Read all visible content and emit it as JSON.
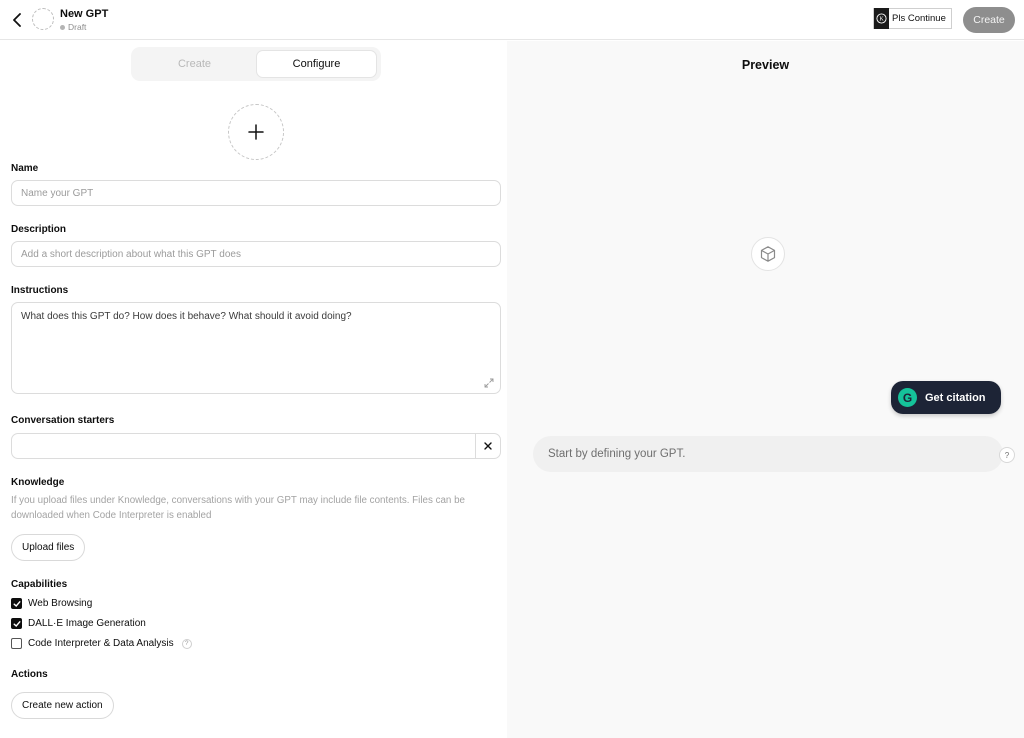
{
  "header": {
    "title": "New GPT",
    "status": "Draft",
    "extension_label": "Pls Continue",
    "create_button": "Create"
  },
  "tabs": [
    {
      "label": "Create",
      "active": false
    },
    {
      "label": "Configure",
      "active": true
    }
  ],
  "form": {
    "name": {
      "label": "Name",
      "placeholder": "Name your GPT"
    },
    "description": {
      "label": "Description",
      "placeholder": "Add a short description about what this GPT does"
    },
    "instructions": {
      "label": "Instructions",
      "placeholder": "What does this GPT do? How does it behave? What should it avoid doing?"
    },
    "starters": {
      "label": "Conversation starters",
      "value": ""
    },
    "knowledge": {
      "label": "Knowledge",
      "help": "If you upload files under Knowledge, conversations with your GPT may include file contents. Files can be downloaded when Code Interpreter is enabled",
      "upload_button": "Upload files"
    },
    "capabilities": {
      "label": "Capabilities",
      "items": [
        {
          "label": "Web Browsing",
          "checked": true
        },
        {
          "label": "DALL·E Image Generation",
          "checked": true
        },
        {
          "label": "Code Interpreter & Data Analysis",
          "checked": false
        }
      ]
    },
    "actions": {
      "label": "Actions",
      "button": "Create new action"
    }
  },
  "preview": {
    "title": "Preview",
    "composer_placeholder": "Start by defining your GPT.",
    "help_label": "?"
  },
  "grammarly": {
    "label": "Get citation",
    "logo": "G"
  },
  "colors": {
    "citation_bg": "#1d2436",
    "grammarly_green": "#15c39a",
    "create_disabled": "#8e8e8e"
  },
  "icons": [
    "chevron-left-icon",
    "plus-icon",
    "cube-icon",
    "expand-icon",
    "close-icon",
    "check-icon",
    "question-icon"
  ]
}
